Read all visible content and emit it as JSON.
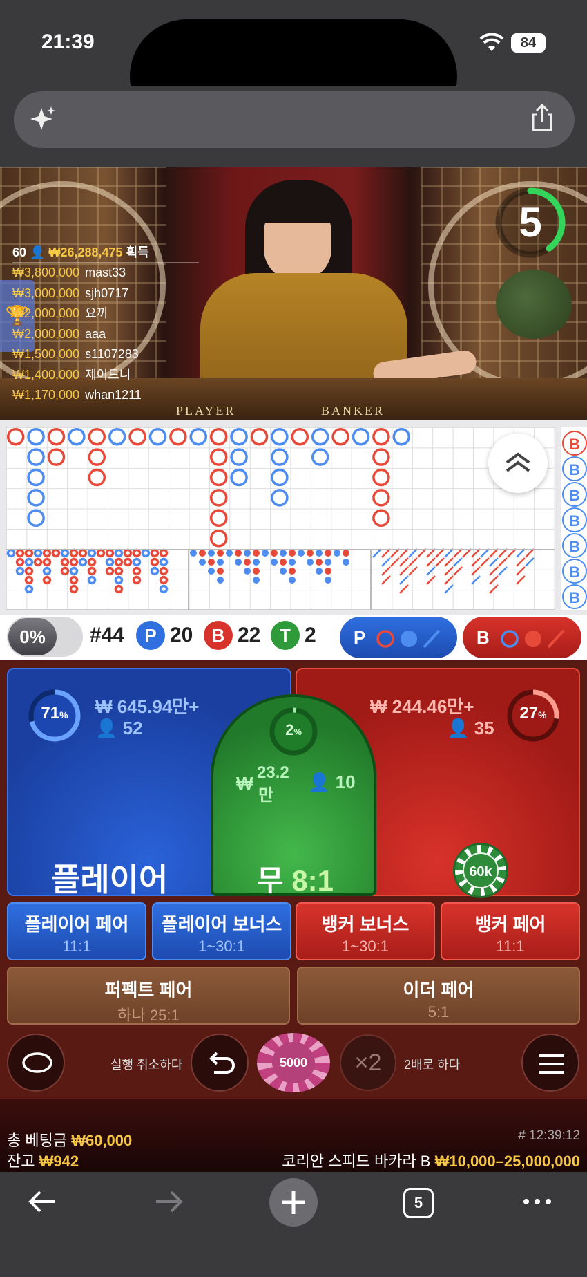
{
  "status_bar": {
    "time": "21:39",
    "battery": "84"
  },
  "live": {
    "timer": "5",
    "winners_header": {
      "count": "60",
      "amount": "₩26,288,475",
      "suffix": "획득"
    },
    "winners": [
      {
        "amount": "₩3,800,000",
        "name": "mast33"
      },
      {
        "amount": "₩3,000,000",
        "name": "sjh0717"
      },
      {
        "amount": "₩2,000,000",
        "name": "요끼"
      },
      {
        "amount": "₩2,000,000",
        "name": "aaa"
      },
      {
        "amount": "₩1,500,000",
        "name": "s1107283"
      },
      {
        "amount": "₩1,400,000",
        "name": "제이드니"
      },
      {
        "amount": "₩1,170,000",
        "name": "whan1211"
      }
    ],
    "felt_player": "PLAYER",
    "felt_banker": "BANKER"
  },
  "roads": {
    "side_label": "B"
  },
  "stats": {
    "percent_toggle": "0%",
    "shoe": "#44",
    "player_letter": "P",
    "player_count": "20",
    "banker_letter": "B",
    "banker_count": "22",
    "tie_letter": "T",
    "tie_count": "2",
    "player_predict": "P",
    "banker_predict": "B"
  },
  "bets": {
    "player": {
      "percent": "71",
      "pct_sign": "%",
      "pool": "₩ 645.94만+",
      "players": "52",
      "label": "플레이어"
    },
    "banker": {
      "percent": "27",
      "pct_sign": "%",
      "pool": "₩ 244.46만+",
      "players": "35",
      "chip": "60k"
    },
    "tie": {
      "percent": "2",
      "pct_sign": "%",
      "pool_currency": "₩",
      "pool_value": "23.2",
      "pool_unit": "만",
      "players": "10",
      "label": "무",
      "odds": "8:1"
    },
    "side": [
      {
        "label": "플레이어 페어",
        "odds": "11:1"
      },
      {
        "label": "플레이어 보너스",
        "odds": "1~30:1"
      },
      {
        "label": "뱅커 보너스",
        "odds": "1~30:1"
      },
      {
        "label": "뱅커 페어",
        "odds": "11:1"
      }
    ],
    "perfect_pair": {
      "label": "퍼펙트 페어",
      "odds": "하나 25:1"
    },
    "either_pair": {
      "label": "이더 페어",
      "odds": "5:1"
    }
  },
  "controls": {
    "undo_label": "실행 취소하다",
    "chip_value": "5000",
    "double_label": "2배로 하다",
    "double_icon_text": "×2"
  },
  "footer": {
    "total_bet_label": "총 베팅금",
    "total_bet": "₩60,000",
    "balance_label": "잔고",
    "balance": "₩942",
    "round": "# 12:39:12",
    "table_name": "코리안 스피드 바카라 B",
    "limits": "₩10,000–25,000,000"
  },
  "browser": {
    "tab_count": "5"
  },
  "colors": {
    "player": "#2f6fe0",
    "banker": "#d8332b",
    "tie": "#2f9a3a",
    "gold": "#f6c744"
  }
}
